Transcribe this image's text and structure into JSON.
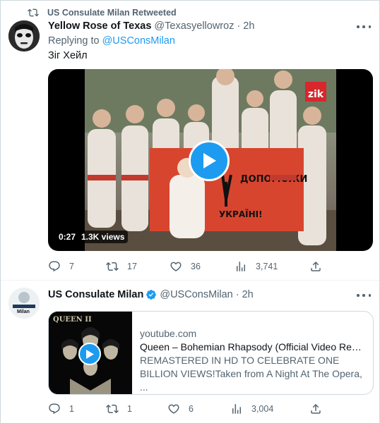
{
  "retweet_context": {
    "text": "US Consulate Milan Retweeted"
  },
  "tweet1": {
    "author_name": "Yellow Rose of Texas",
    "handle": "@Texasyellowroz",
    "time": "· 2h",
    "replying_label": "Replying to",
    "replying_handle": "@USConsMilan",
    "text": "Зіг Хейл",
    "video": {
      "duration": "0:27",
      "views": "1.3K views",
      "watermark": "zik"
    },
    "counts": {
      "replies": "7",
      "retweets": "17",
      "likes": "36",
      "views": "3,741"
    }
  },
  "tweet2": {
    "author_name": "US Consulate Milan",
    "handle": "@USConsMilan",
    "time": "· 2h",
    "avatar_label": "Milan",
    "card": {
      "domain": "youtube.com",
      "title": "Queen – Bohemian Rhapsody (Official Video Rem...",
      "description": "REMASTERED IN HD TO CELEBRATE ONE BILLION VIEWS!Taken from A Night At The Opera, ...",
      "thumb_logo": "QUEEN II"
    },
    "counts": {
      "replies": "1",
      "retweets": "1",
      "likes": "6",
      "views": "3,004"
    }
  },
  "colors": {
    "accent": "#1d9bf0",
    "text": "#0f1419",
    "muted": "#536471",
    "border": "#cfd9de"
  },
  "icons": [
    "retweet-icon",
    "more-icon",
    "reply-icon",
    "like-icon",
    "views-icon",
    "share-icon",
    "verified-icon",
    "play-icon"
  ]
}
